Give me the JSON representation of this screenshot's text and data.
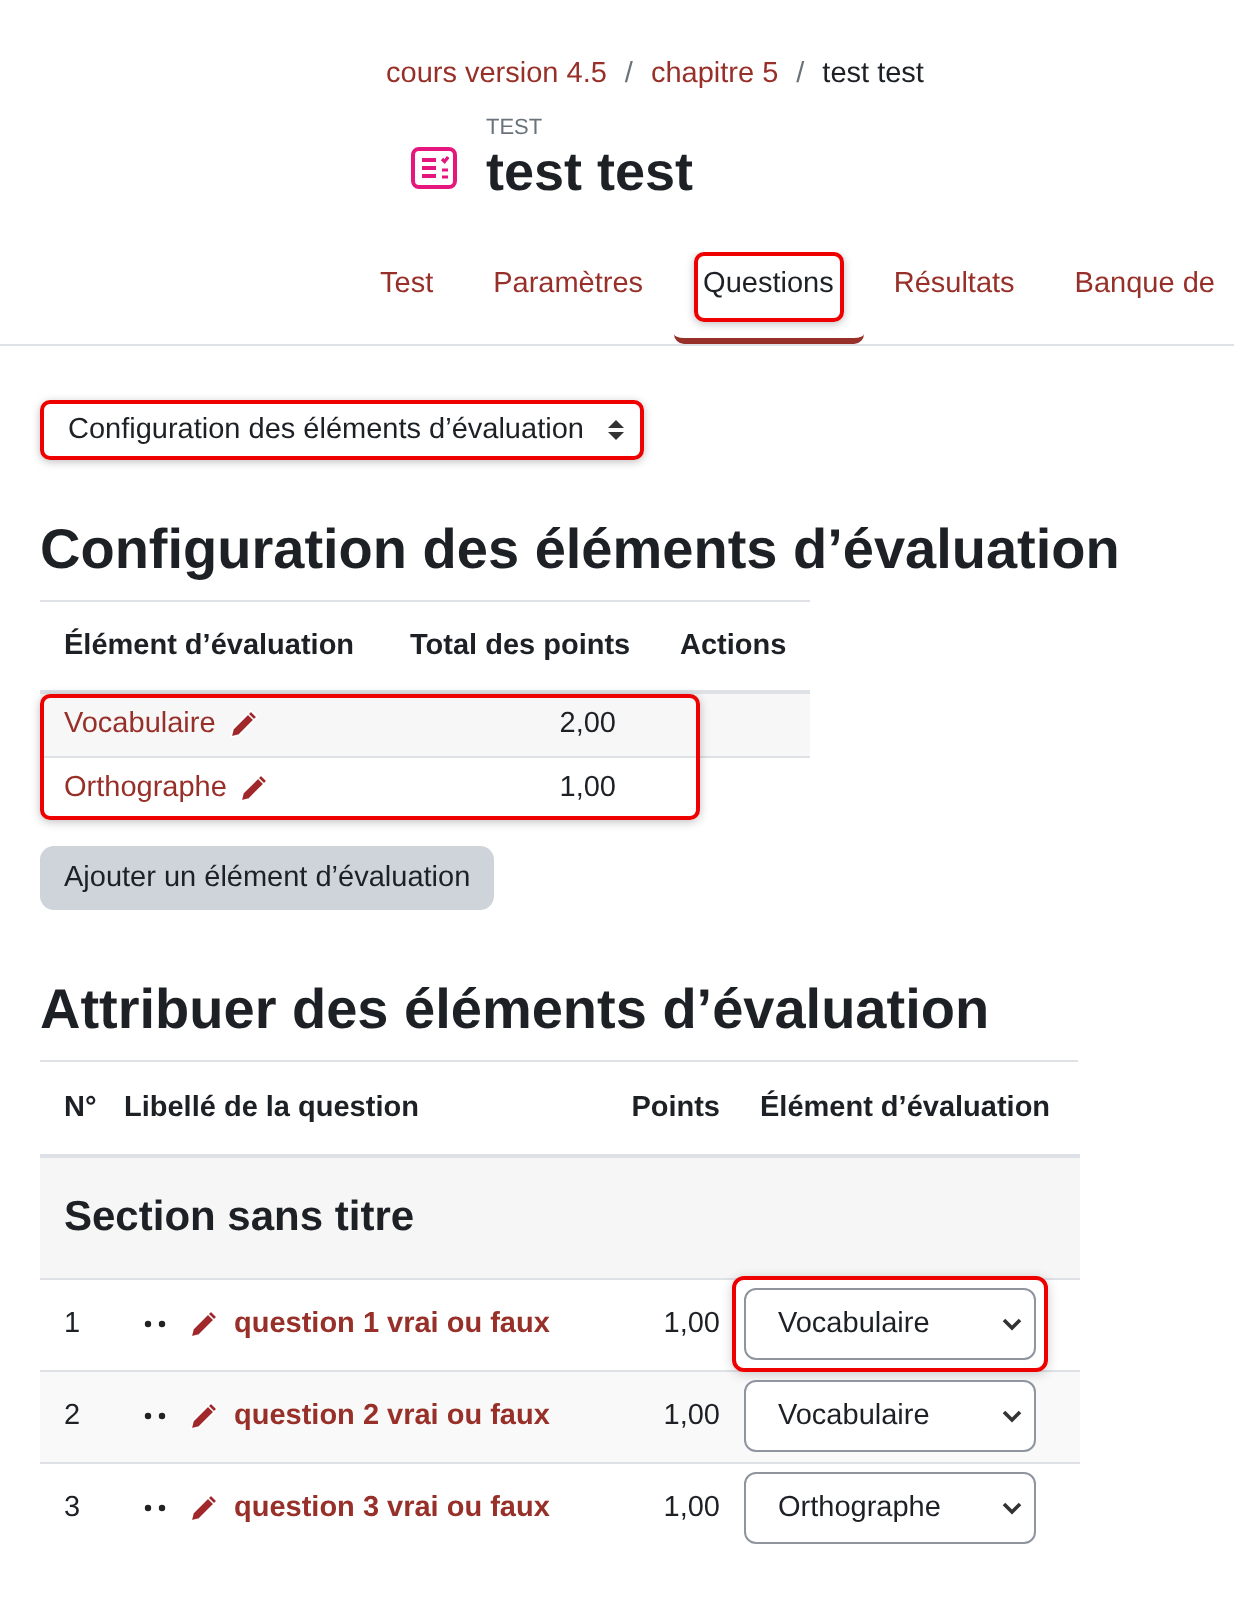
{
  "breadcrumb": [
    {
      "label": "cours version 4.5",
      "link": true
    },
    {
      "separator_before": "/",
      "label": "chapitre 5",
      "link": true
    },
    {
      "separator_before": "/",
      "label": "test test",
      "link": false
    }
  ],
  "header": {
    "kicker": "TEST",
    "title": "test test"
  },
  "tabs": [
    {
      "label": "Test",
      "selected": false,
      "highlighted": false
    },
    {
      "label": "Paramètres",
      "selected": false,
      "highlighted": false
    },
    {
      "label": "Questions",
      "selected": true,
      "highlighted": true
    },
    {
      "label": "Résultats",
      "selected": false,
      "highlighted": false
    },
    {
      "label": "Banque de",
      "selected": false,
      "highlighted": false
    }
  ],
  "view_select": {
    "value": "Configuration des éléments d’évaluation",
    "highlighted": true
  },
  "grade_items": {
    "heading": "Configuration des éléments d’évaluation",
    "columns": [
      "Élément d’évaluation",
      "Total des points",
      "Actions"
    ],
    "rows_highlighted": true,
    "rows": [
      {
        "name": "Vocabulaire",
        "total": "2,00"
      },
      {
        "name": "Orthographe",
        "total": "1,00"
      }
    ],
    "add_button": "Ajouter un élément d’évaluation"
  },
  "assign": {
    "heading": "Attribuer des éléments d’évaluation",
    "columns": [
      "N°",
      "Libellé de la question",
      "Points",
      "Élément d’évaluation"
    ],
    "section": "Section sans titre",
    "rows": [
      {
        "number": "1",
        "question": "question 1 vrai ou faux",
        "points": "1,00",
        "grade_item": "Vocabulaire",
        "highlighted": true
      },
      {
        "number": "2",
        "question": "question 2 vrai ou faux",
        "points": "1,00",
        "grade_item": "Vocabulaire",
        "highlighted": false
      },
      {
        "number": "3",
        "question": "question 3 vrai ou faux",
        "points": "1,00",
        "grade_item": "Orthographe",
        "highlighted": false
      }
    ]
  }
}
